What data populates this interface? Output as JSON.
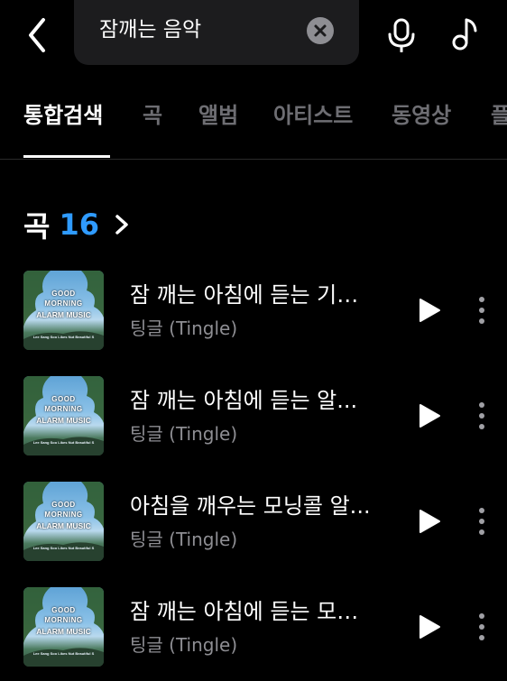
{
  "search": {
    "query": "잠깨는 음악"
  },
  "tabs": [
    {
      "label": "통합검색",
      "active": true
    },
    {
      "label": "곡",
      "active": false
    },
    {
      "label": "앨범",
      "active": false
    },
    {
      "label": "아티스트",
      "active": false
    },
    {
      "label": "동영상",
      "active": false
    },
    {
      "label": "플",
      "active": false
    }
  ],
  "section": {
    "title": "곡",
    "count": "16"
  },
  "album_art": {
    "line1": "GOOD",
    "line2": "MORNING",
    "line3": "ALARM MUSIC",
    "line4": "Lee Sang Soo Likes Nut Beautiful S"
  },
  "songs": [
    {
      "title": "잠 깨는 아침에 듣는 기…",
      "artist": "팅글 (Tingle)"
    },
    {
      "title": "잠 깨는 아침에 듣는 알...",
      "artist": "팅글 (Tingle)"
    },
    {
      "title": "아침을 깨우는 모닝콜 알...",
      "artist": "팅글 (Tingle)"
    },
    {
      "title": "잠 깨는 아침에 듣는 모…",
      "artist": "팅글 (Tingle)"
    }
  ],
  "colors": {
    "background": "#000000",
    "accent": "#2f9bff",
    "inactive_tab": "#6e6e73",
    "secondary_text": "#8e8e93",
    "search_box": "#1c1c1e"
  },
  "icons": {
    "back": "chevron-left-icon",
    "clear": "clear-icon",
    "mic": "microphone-icon",
    "note": "music-note-icon",
    "section_chevron": "chevron-right-icon",
    "play": "play-icon",
    "more": "more-vertical-icon"
  }
}
